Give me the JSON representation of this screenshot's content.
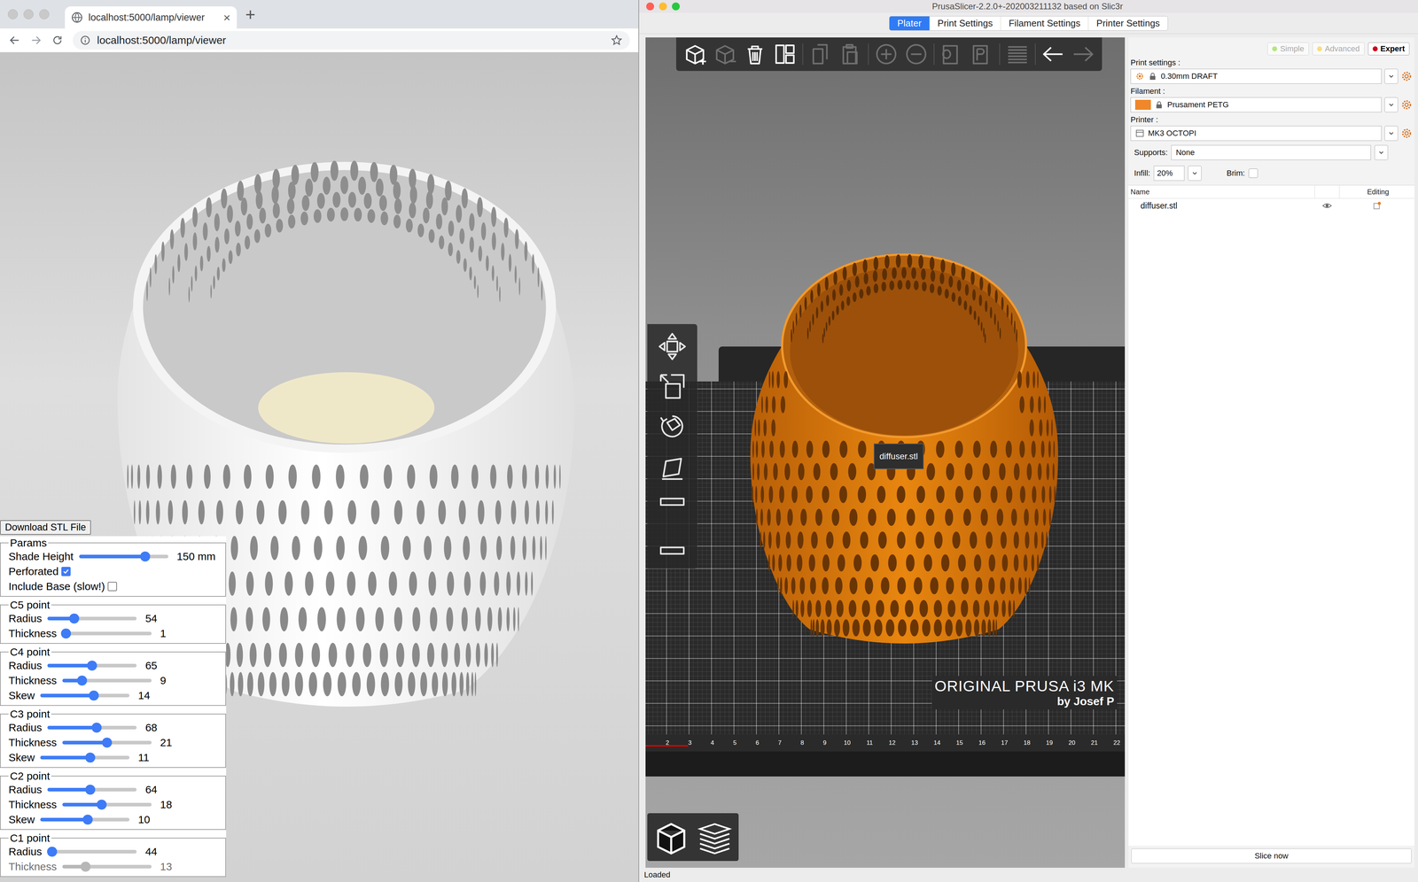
{
  "browser": {
    "tab": {
      "title": "localhost:5000/lamp/viewer",
      "close": "×"
    },
    "new_tab": "+",
    "url": "localhost:5000/lamp/viewer"
  },
  "viewer": {
    "download_button": "Download STL File",
    "params": {
      "legend": "Params",
      "shade_height": {
        "label": "Shade Height",
        "level": 0.74,
        "reading": "150 mm",
        "disabled": false
      },
      "checkboxes": [
        {
          "label": "Perforated",
          "checked": true
        },
        {
          "label": "Include Base (slow!)",
          "checked": false
        }
      ]
    },
    "points": [
      {
        "legend": "C5 point",
        "sliders": [
          {
            "label": "Radius",
            "level": 0.3,
            "reading": "54",
            "disabled": false
          },
          {
            "label": "Thickness",
            "level": 0.04,
            "reading": "1",
            "disabled": false
          }
        ]
      },
      {
        "legend": "C4 point",
        "sliders": [
          {
            "label": "Radius",
            "level": 0.5,
            "reading": "65",
            "disabled": false
          },
          {
            "label": "Thickness",
            "level": 0.22,
            "reading": "9",
            "disabled": false
          },
          {
            "label": "Skew",
            "level": 0.6,
            "reading": "14",
            "disabled": false
          }
        ]
      },
      {
        "legend": "C3 point",
        "sliders": [
          {
            "label": "Radius",
            "level": 0.55,
            "reading": "68",
            "disabled": false
          },
          {
            "label": "Thickness",
            "level": 0.5,
            "reading": "21",
            "disabled": false
          },
          {
            "label": "Skew",
            "level": 0.56,
            "reading": "11",
            "disabled": false
          }
        ]
      },
      {
        "legend": "C2 point",
        "sliders": [
          {
            "label": "Radius",
            "level": 0.48,
            "reading": "64",
            "disabled": false
          },
          {
            "label": "Thickness",
            "level": 0.44,
            "reading": "18",
            "disabled": false
          },
          {
            "label": "Skew",
            "level": 0.53,
            "reading": "10",
            "disabled": false
          }
        ]
      },
      {
        "legend": "C1 point",
        "sliders": [
          {
            "label": "Radius",
            "level": 0.05,
            "reading": "44",
            "disabled": false
          },
          {
            "label": "Thickness",
            "level": 0.26,
            "reading": "13",
            "disabled": true
          }
        ]
      }
    ]
  },
  "slicer": {
    "title": "PrusaSlicer-2.2.0+-202003211132 based on Slic3r",
    "tabs": [
      {
        "label": "Plater",
        "selected": true
      },
      {
        "label": "Print Settings",
        "selected": false
      },
      {
        "label": "Filament Settings",
        "selected": false
      },
      {
        "label": "Printer Settings",
        "selected": false
      }
    ],
    "toolbar": [
      {
        "disabled": false
      },
      {
        "disabled": true
      },
      {
        "disabled": false
      },
      {
        "disabled": false
      },
      {
        "disabled": true
      },
      {
        "disabled": true
      },
      {
        "disabled": true
      },
      {
        "disabled": true
      },
      {
        "disabled": true
      },
      {
        "disabled": true
      },
      {
        "disabled": true
      },
      {
        "disabled": false
      },
      {
        "disabled": true
      }
    ],
    "tooltip": "diffuser.stl",
    "bed": {
      "brand": "ORIGINAL PRUSA i3 MK",
      "maker": "by Josef P",
      "ruler": [
        "2",
        "3",
        "4",
        "5",
        "6",
        "7",
        "8",
        "9",
        "10",
        "11",
        "12",
        "13",
        "14",
        "15",
        "16",
        "17",
        "18",
        "19",
        "20",
        "21",
        "22"
      ]
    },
    "modes": [
      {
        "label": "Simple",
        "color": "#7ed321",
        "selected": false
      },
      {
        "label": "Advanced",
        "color": "#f5c518",
        "selected": false
      },
      {
        "label": "Expert",
        "color": "#d0021b",
        "selected": true
      }
    ],
    "presets": [
      {
        "label": "Print settings :",
        "value": "0.30mm DRAFT",
        "kind": "print"
      },
      {
        "label": "Filament :",
        "value": "Prusament PETG",
        "kind": "filament",
        "color": "#f0872a"
      },
      {
        "label": "Printer :",
        "value": "MK3 OCTOPI",
        "kind": "printer"
      }
    ],
    "supports": {
      "label": "Supports:",
      "value": "None"
    },
    "infill": {
      "label": "Infill:",
      "value": "20%"
    },
    "brim": {
      "label": "Brim:",
      "checked": false
    },
    "object_list": {
      "columns": [
        "Name",
        "Editing"
      ],
      "rows": [
        {
          "name": "diffuser.stl"
        }
      ]
    },
    "slice_button": "Slice now",
    "status": "Loaded"
  }
}
